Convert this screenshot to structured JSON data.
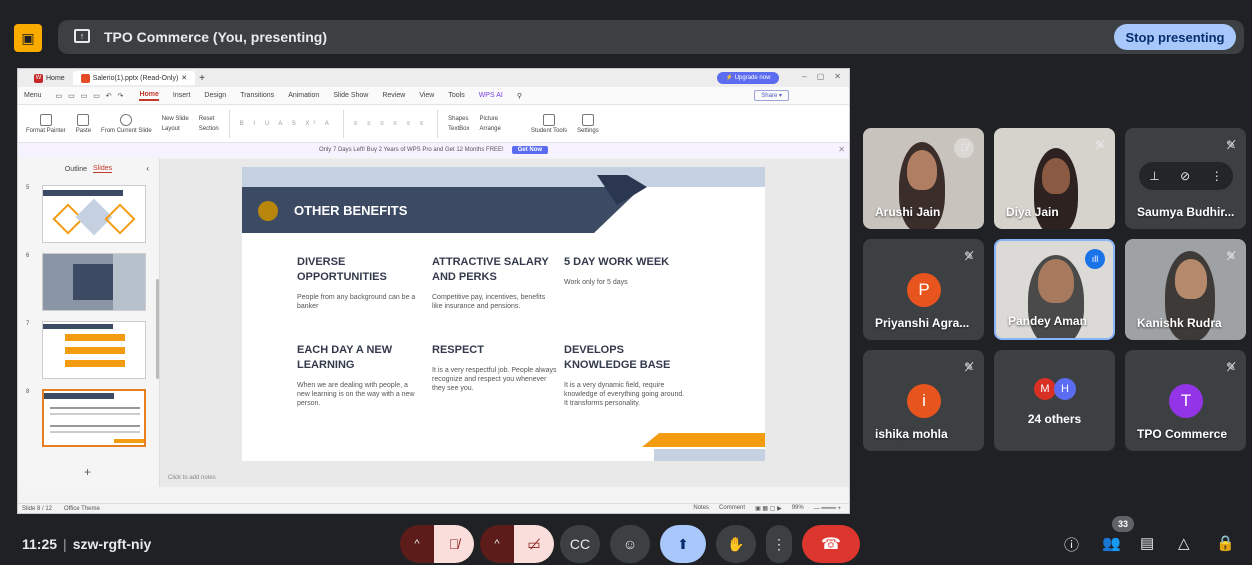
{
  "topbar": {
    "presenting_title": "TPO Commerce (You, presenting)",
    "stop_label": "Stop presenting",
    "badge_color": "#f9ab00"
  },
  "wps": {
    "tabs": [
      {
        "label": "Home",
        "icon": "wps-logo-icon"
      },
      {
        "label": "Salerio(1).pptx (Read-Only)",
        "icon": "presentation-file-icon"
      }
    ],
    "upgrade_label": "⚡ Upgrade now",
    "menu": [
      "Menu",
      "Home",
      "Insert",
      "Design",
      "Transitions",
      "Animation",
      "Slide Show",
      "Review",
      "View",
      "Tools",
      "WPS AI"
    ],
    "share_label": "Share ▾",
    "ribbon": {
      "format_painter": "Format Painter",
      "paste": "Paste",
      "from_current": "From Current Slide",
      "new_slide": "New Slide",
      "layout": "Layout",
      "reset": "Reset",
      "section": "Section",
      "shapes": "Shapes",
      "picture": "Picture",
      "textbox": "TextBox",
      "arrange": "Arrange",
      "student_tools": "Student Tools",
      "settings": "Settings"
    },
    "promo_text": "Only 7 Days Left! Buy 2 Years of WPS Pro and Get 12 Months FREE!",
    "promo_btn": "Get Now",
    "side_tabs": [
      "Outline",
      "Slides"
    ],
    "thumb_numbers": [
      "5",
      "6",
      "7",
      "8"
    ],
    "notes_placeholder": "Click to add notes",
    "status_left": "Slide 8 / 12",
    "status_theme": "Office Theme",
    "status_notes": "Notes",
    "status_comment": "Comment",
    "zoom": "99%"
  },
  "slide": {
    "title": "OTHER BENEFITS",
    "cards": [
      {
        "heading": "DIVERSE OPPORTUNITIES",
        "body": "People from any background can be a banker"
      },
      {
        "heading": "ATTRACTIVE SALARY AND PERKS",
        "body": "Competitive pay, incentives, benefits like insurance and pensions."
      },
      {
        "heading": "5 DAY WORK WEEK",
        "body": "Work only for 5 days"
      },
      {
        "heading": "EACH DAY A NEW LEARNING",
        "body": "When we are dealing with people, a new learning is on the way with a new person."
      },
      {
        "heading": "RESPECT",
        "body": "It is a very respectful job. People always recognize and respect you whenever they see you."
      },
      {
        "heading": "DEVELOPS KNOWLEDGE BASE",
        "body": "It is a very dynamic field, require knowledge of everything going around. It transforms personality."
      }
    ]
  },
  "participants": [
    {
      "name": "Arushi Jain",
      "type": "video",
      "mic": "off"
    },
    {
      "name": "Diya Jain",
      "type": "video",
      "mic": "off"
    },
    {
      "name": "Saumya Budhir...",
      "type": "hover",
      "mic": "off"
    },
    {
      "name": "Priyanshi Agra...",
      "type": "avatar",
      "initial": "P",
      "color": "#e8541d",
      "mic": "off"
    },
    {
      "name": "Pandey Aman",
      "type": "video",
      "mic": "speaking"
    },
    {
      "name": "Kanishk Rudra",
      "type": "video",
      "mic": "off"
    },
    {
      "name": "ishika mohla",
      "type": "avatar",
      "initial": "i",
      "color": "#e8541d",
      "mic": "off"
    },
    {
      "name": "24 others",
      "type": "others",
      "initials": [
        "M",
        "H"
      ]
    },
    {
      "name": "TPO Commerce",
      "type": "avatar",
      "initial": "T",
      "color": "#9334e6",
      "mic": "off"
    }
  ],
  "bottom": {
    "time": "11:25",
    "meeting_code": "szw-rgft-niy",
    "people_count": "33"
  }
}
